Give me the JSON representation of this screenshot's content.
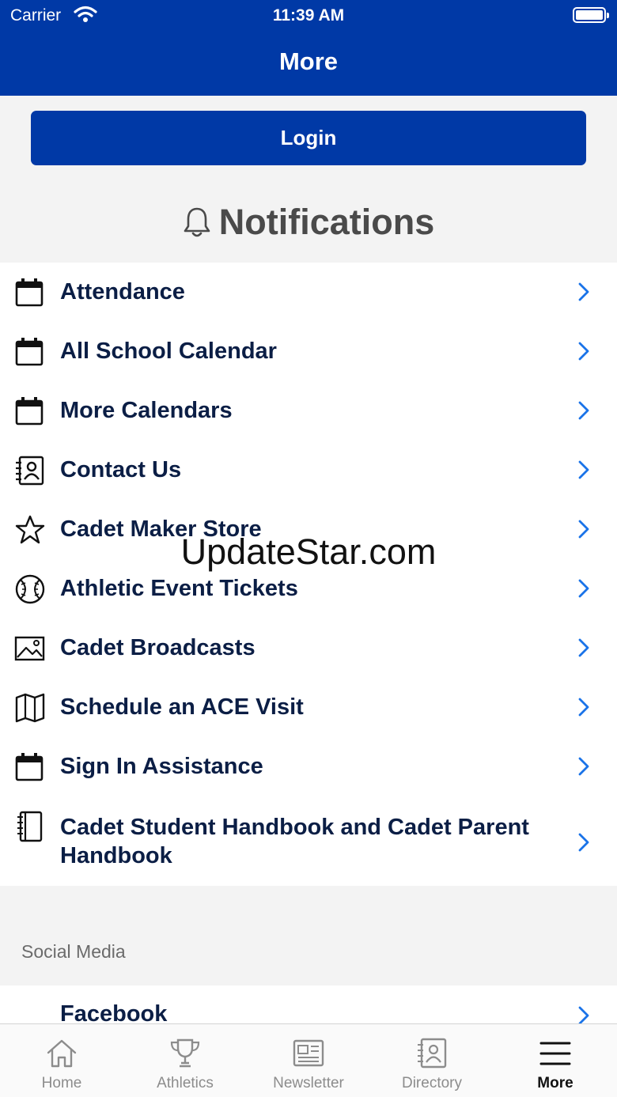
{
  "status_bar": {
    "carrier": "Carrier",
    "time": "11:39 AM"
  },
  "nav": {
    "title": "More"
  },
  "login": {
    "label": "Login"
  },
  "notifications": {
    "label": "Notifications"
  },
  "menu": {
    "items": [
      {
        "label": "Attendance",
        "icon": "calendar-icon"
      },
      {
        "label": "All School Calendar",
        "icon": "calendar-icon"
      },
      {
        "label": "More Calendars",
        "icon": "calendar-icon"
      },
      {
        "label": "Contact Us",
        "icon": "contact-book-icon"
      },
      {
        "label": "Cadet Maker Store",
        "icon": "star-icon"
      },
      {
        "label": "Athletic Event Tickets",
        "icon": "baseball-icon"
      },
      {
        "label": "Cadet Broadcasts",
        "icon": "image-icon"
      },
      {
        "label": "Schedule an ACE Visit",
        "icon": "map-icon"
      },
      {
        "label": "Sign In Assistance",
        "icon": "calendar-icon"
      },
      {
        "label": "Cadet Student Handbook and Cadet Parent Handbook",
        "icon": "notebook-icon"
      }
    ]
  },
  "social": {
    "header": "Social Media",
    "items": [
      {
        "label": "Facebook"
      }
    ]
  },
  "tabbar": {
    "tabs": [
      {
        "label": "Home",
        "icon": "home-icon"
      },
      {
        "label": "Athletics",
        "icon": "trophy-icon"
      },
      {
        "label": "Newsletter",
        "icon": "newspaper-icon"
      },
      {
        "label": "Directory",
        "icon": "directory-icon"
      },
      {
        "label": "More",
        "icon": "menu-icon",
        "active": true
      }
    ]
  },
  "watermark": {
    "text": "UpdateStar.com"
  },
  "colors": {
    "primary": "#0039a6",
    "text": "#0b1e45",
    "chevron": "#1a73e8",
    "background": "#f3f3f3"
  }
}
